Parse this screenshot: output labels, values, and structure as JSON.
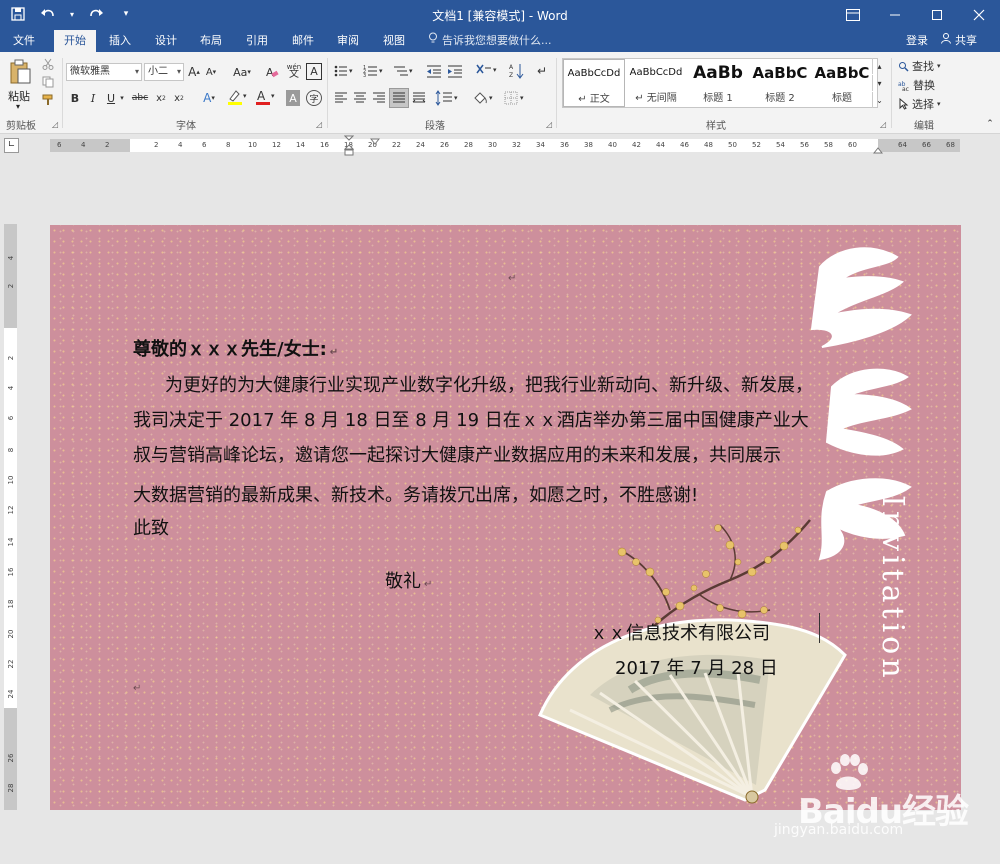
{
  "window": {
    "title": "文档1 [兼容模式] - Word",
    "controls": [
      "restore-ribbon",
      "minimize",
      "maximize",
      "close"
    ]
  },
  "quick_access": {
    "icons": [
      "save-icon",
      "undo-icon",
      "redo-icon",
      "customize-icon"
    ]
  },
  "tabs": [
    {
      "label": "文件",
      "active": false
    },
    {
      "label": "开始",
      "active": true
    },
    {
      "label": "插入",
      "active": false
    },
    {
      "label": "设计",
      "active": false
    },
    {
      "label": "布局",
      "active": false
    },
    {
      "label": "引用",
      "active": false
    },
    {
      "label": "邮件",
      "active": false
    },
    {
      "label": "审阅",
      "active": false
    },
    {
      "label": "视图",
      "active": false
    }
  ],
  "tell_me": "告诉我您想要做什么...",
  "account": {
    "login": "登录",
    "share": "共享"
  },
  "ribbon": {
    "clipboard": {
      "paste": "粘贴",
      "label": "剪贴板"
    },
    "font": {
      "name": "微软雅黑",
      "size": "小二",
      "label": "字体",
      "case": "Aa",
      "pinyin": "wén"
    },
    "paragraph": {
      "label": "段落"
    },
    "styles": {
      "label": "样式",
      "items": [
        {
          "sample": "AaBbCcDd",
          "name": "↵ 正文"
        },
        {
          "sample": "AaBbCcDd",
          "name": "↵ 无间隔"
        },
        {
          "sample": "AaBb",
          "name": "标题 1"
        },
        {
          "sample": "AaBbC",
          "name": "标题 2"
        },
        {
          "sample": "AaBbC",
          "name": "标题"
        }
      ]
    },
    "editing": {
      "find": "查找",
      "replace": "替换",
      "select": "选择",
      "label": "编辑"
    }
  },
  "ruler": {
    "h_ticks": [
      "6",
      "4",
      "2",
      "2",
      "4",
      "6",
      "8",
      "10",
      "12",
      "14",
      "16",
      "18",
      "20",
      "22",
      "24",
      "26",
      "28",
      "30",
      "32",
      "34",
      "36",
      "38",
      "40",
      "42",
      "44",
      "46",
      "48",
      "50",
      "52",
      "54",
      "56",
      "58",
      "60",
      "64",
      "66",
      "68"
    ],
    "v_ticks": [
      "4",
      "2",
      "2",
      "4",
      "6",
      "8",
      "10",
      "12",
      "14",
      "16",
      "18",
      "20",
      "22",
      "24",
      "26",
      "28"
    ]
  },
  "document": {
    "greeting": "尊敬的ｘｘｘ先生/女士:",
    "lines": [
      "为更好的为大健康行业实现产业数字化升级，把我行业新动向、新升级、新发展，",
      "我司决定于 2017 年 8 月 18 日至 8 月 19 日在ｘｘ酒店举办第三届中国健康产业大",
      "叔与营销高峰论坛，邀请您一起探讨大健康产业数据应用的未来和发展，共同展示",
      "大数据营销的最新成果、新技术。务请拨冗出席，如愿之时，不胜感谢!"
    ],
    "closing1": "此致",
    "closing2": "敬礼",
    "company": "ｘｘ信息技术有限公司",
    "date": "2017 年 7 月 28 日",
    "paragraph_mark": "↵",
    "invitation": "Invitation",
    "calligraphy_chars": "邀请函"
  },
  "watermark": {
    "title": "Baidu经验",
    "url": "jingyan.baidu.com"
  }
}
